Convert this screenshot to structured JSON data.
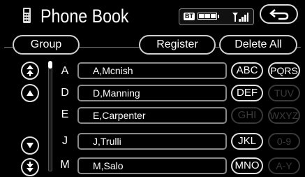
{
  "header": {
    "title": "Phone Book",
    "status": {
      "bt_label": "BT"
    }
  },
  "buttons": {
    "group": "Group",
    "register": "Register",
    "delete_all": "Delete All"
  },
  "rows": [
    {
      "letter": "A",
      "name": "A,Mcnish"
    },
    {
      "letter": "D",
      "name": "D,Manning"
    },
    {
      "letter": "E",
      "name": "E,Carpenter"
    },
    {
      "letter": "J",
      "name": "J,Trulli"
    },
    {
      "letter": "M",
      "name": "M,Salo"
    }
  ],
  "index_buttons": [
    {
      "label": "ABC",
      "enabled": true
    },
    {
      "label": "PQRS",
      "enabled": true
    },
    {
      "label": "DEF",
      "enabled": true
    },
    {
      "label": "TUV",
      "enabled": false
    },
    {
      "label": "GHI",
      "enabled": false
    },
    {
      "label": "WXYZ",
      "enabled": false
    },
    {
      "label": "JKL",
      "enabled": true
    },
    {
      "label": "0-9",
      "enabled": false
    },
    {
      "label": "MNO",
      "enabled": true
    },
    {
      "label": "A-Y",
      "enabled": false
    }
  ],
  "icons": {
    "phone": "phone-handset-icon",
    "battery": "battery-icon",
    "signal": "signal-strength-icon",
    "back": "back-arrow-icon",
    "page_up": "double-up-arrow-icon",
    "up": "up-arrow-icon",
    "down": "down-arrow-icon",
    "page_down": "double-down-arrow-icon"
  },
  "colors": {
    "background": "#000000",
    "border": "#d0d0d0",
    "disabled": "#3a3a3a"
  }
}
